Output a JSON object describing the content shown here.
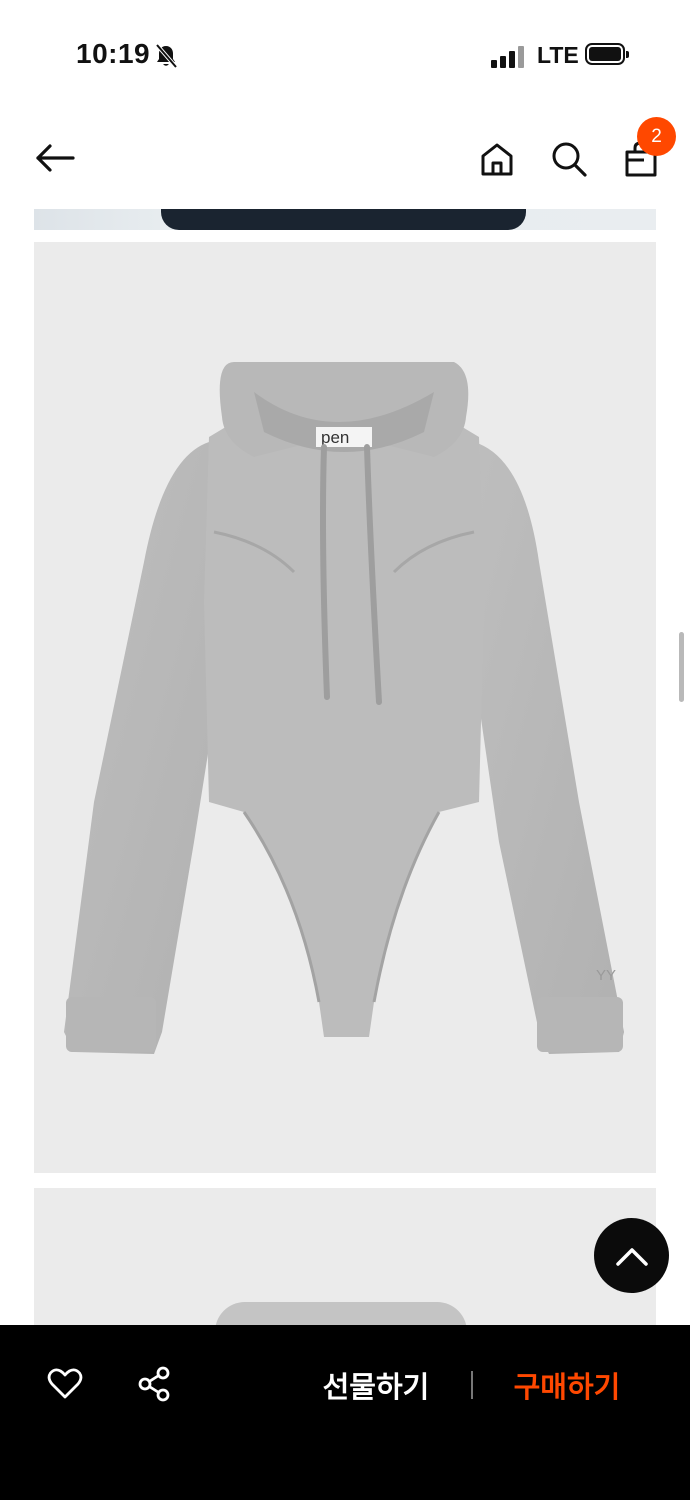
{
  "status_bar": {
    "time": "10:19",
    "network": "LTE",
    "icons": [
      "bell-off-icon",
      "signal-icon",
      "battery-icon"
    ]
  },
  "header": {
    "icons": [
      "back-arrow-icon",
      "home-icon",
      "search-icon",
      "shopping-bag-icon"
    ],
    "cart_count": "2",
    "badge_color": "#ff4800"
  },
  "product_image": {
    "label_text": "pen",
    "logo_text": "YY"
  },
  "bottom_bar": {
    "gift_label": "선물하기",
    "buy_label": "구매하기",
    "accent_color": "#ff4800",
    "icons": [
      "heart-icon",
      "share-icon"
    ]
  },
  "scroll_top_icon": "chevron-up-icon"
}
